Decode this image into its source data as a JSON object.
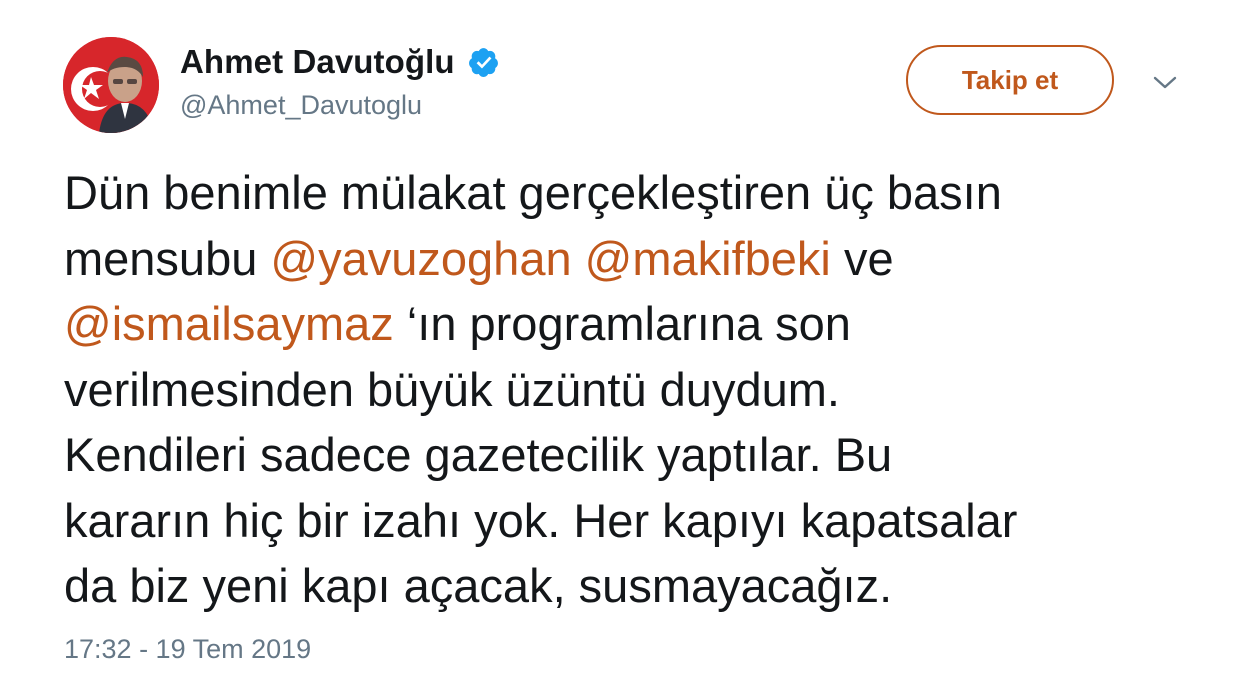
{
  "user": {
    "display_name": "Ahmet Davutoğlu",
    "handle": "@Ahmet_Davutoglu",
    "verified": true,
    "avatar_icon": "profile-photo"
  },
  "actions": {
    "follow_label": "Takip et",
    "more_icon": "chevron-down-icon"
  },
  "tweet": {
    "lines": [
      [
        {
          "text": "Dün benimle mülakat gerçekleştiren üç basın"
        }
      ],
      [
        {
          "text": "mensubu "
        },
        {
          "text": "@yavuzoghan",
          "mention": true
        },
        {
          "text": " "
        },
        {
          "text": "@makifbeki",
          "mention": true
        },
        {
          "text": " ve"
        }
      ],
      [
        {
          "text": "@ismailsaymaz",
          "mention": true
        },
        {
          "text": " ‘ın programlarına son"
        }
      ],
      [
        {
          "text": "verilmesinden büyük üzüntü duydum."
        }
      ],
      [
        {
          "text": "Kendileri sadece gazetecilik yaptılar. Bu"
        }
      ],
      [
        {
          "text": "kararın hiç bir izahı yok. Her kapıyı kapatsalar"
        }
      ],
      [
        {
          "text": "da biz yeni kapı açacak, susmayacağız."
        }
      ]
    ],
    "timestamp": "17:32 - 19 Tem 2019"
  },
  "colors": {
    "accent": "#c0581c",
    "text": "#14171a",
    "secondary": "#657786",
    "verified": "#1da1f2"
  }
}
